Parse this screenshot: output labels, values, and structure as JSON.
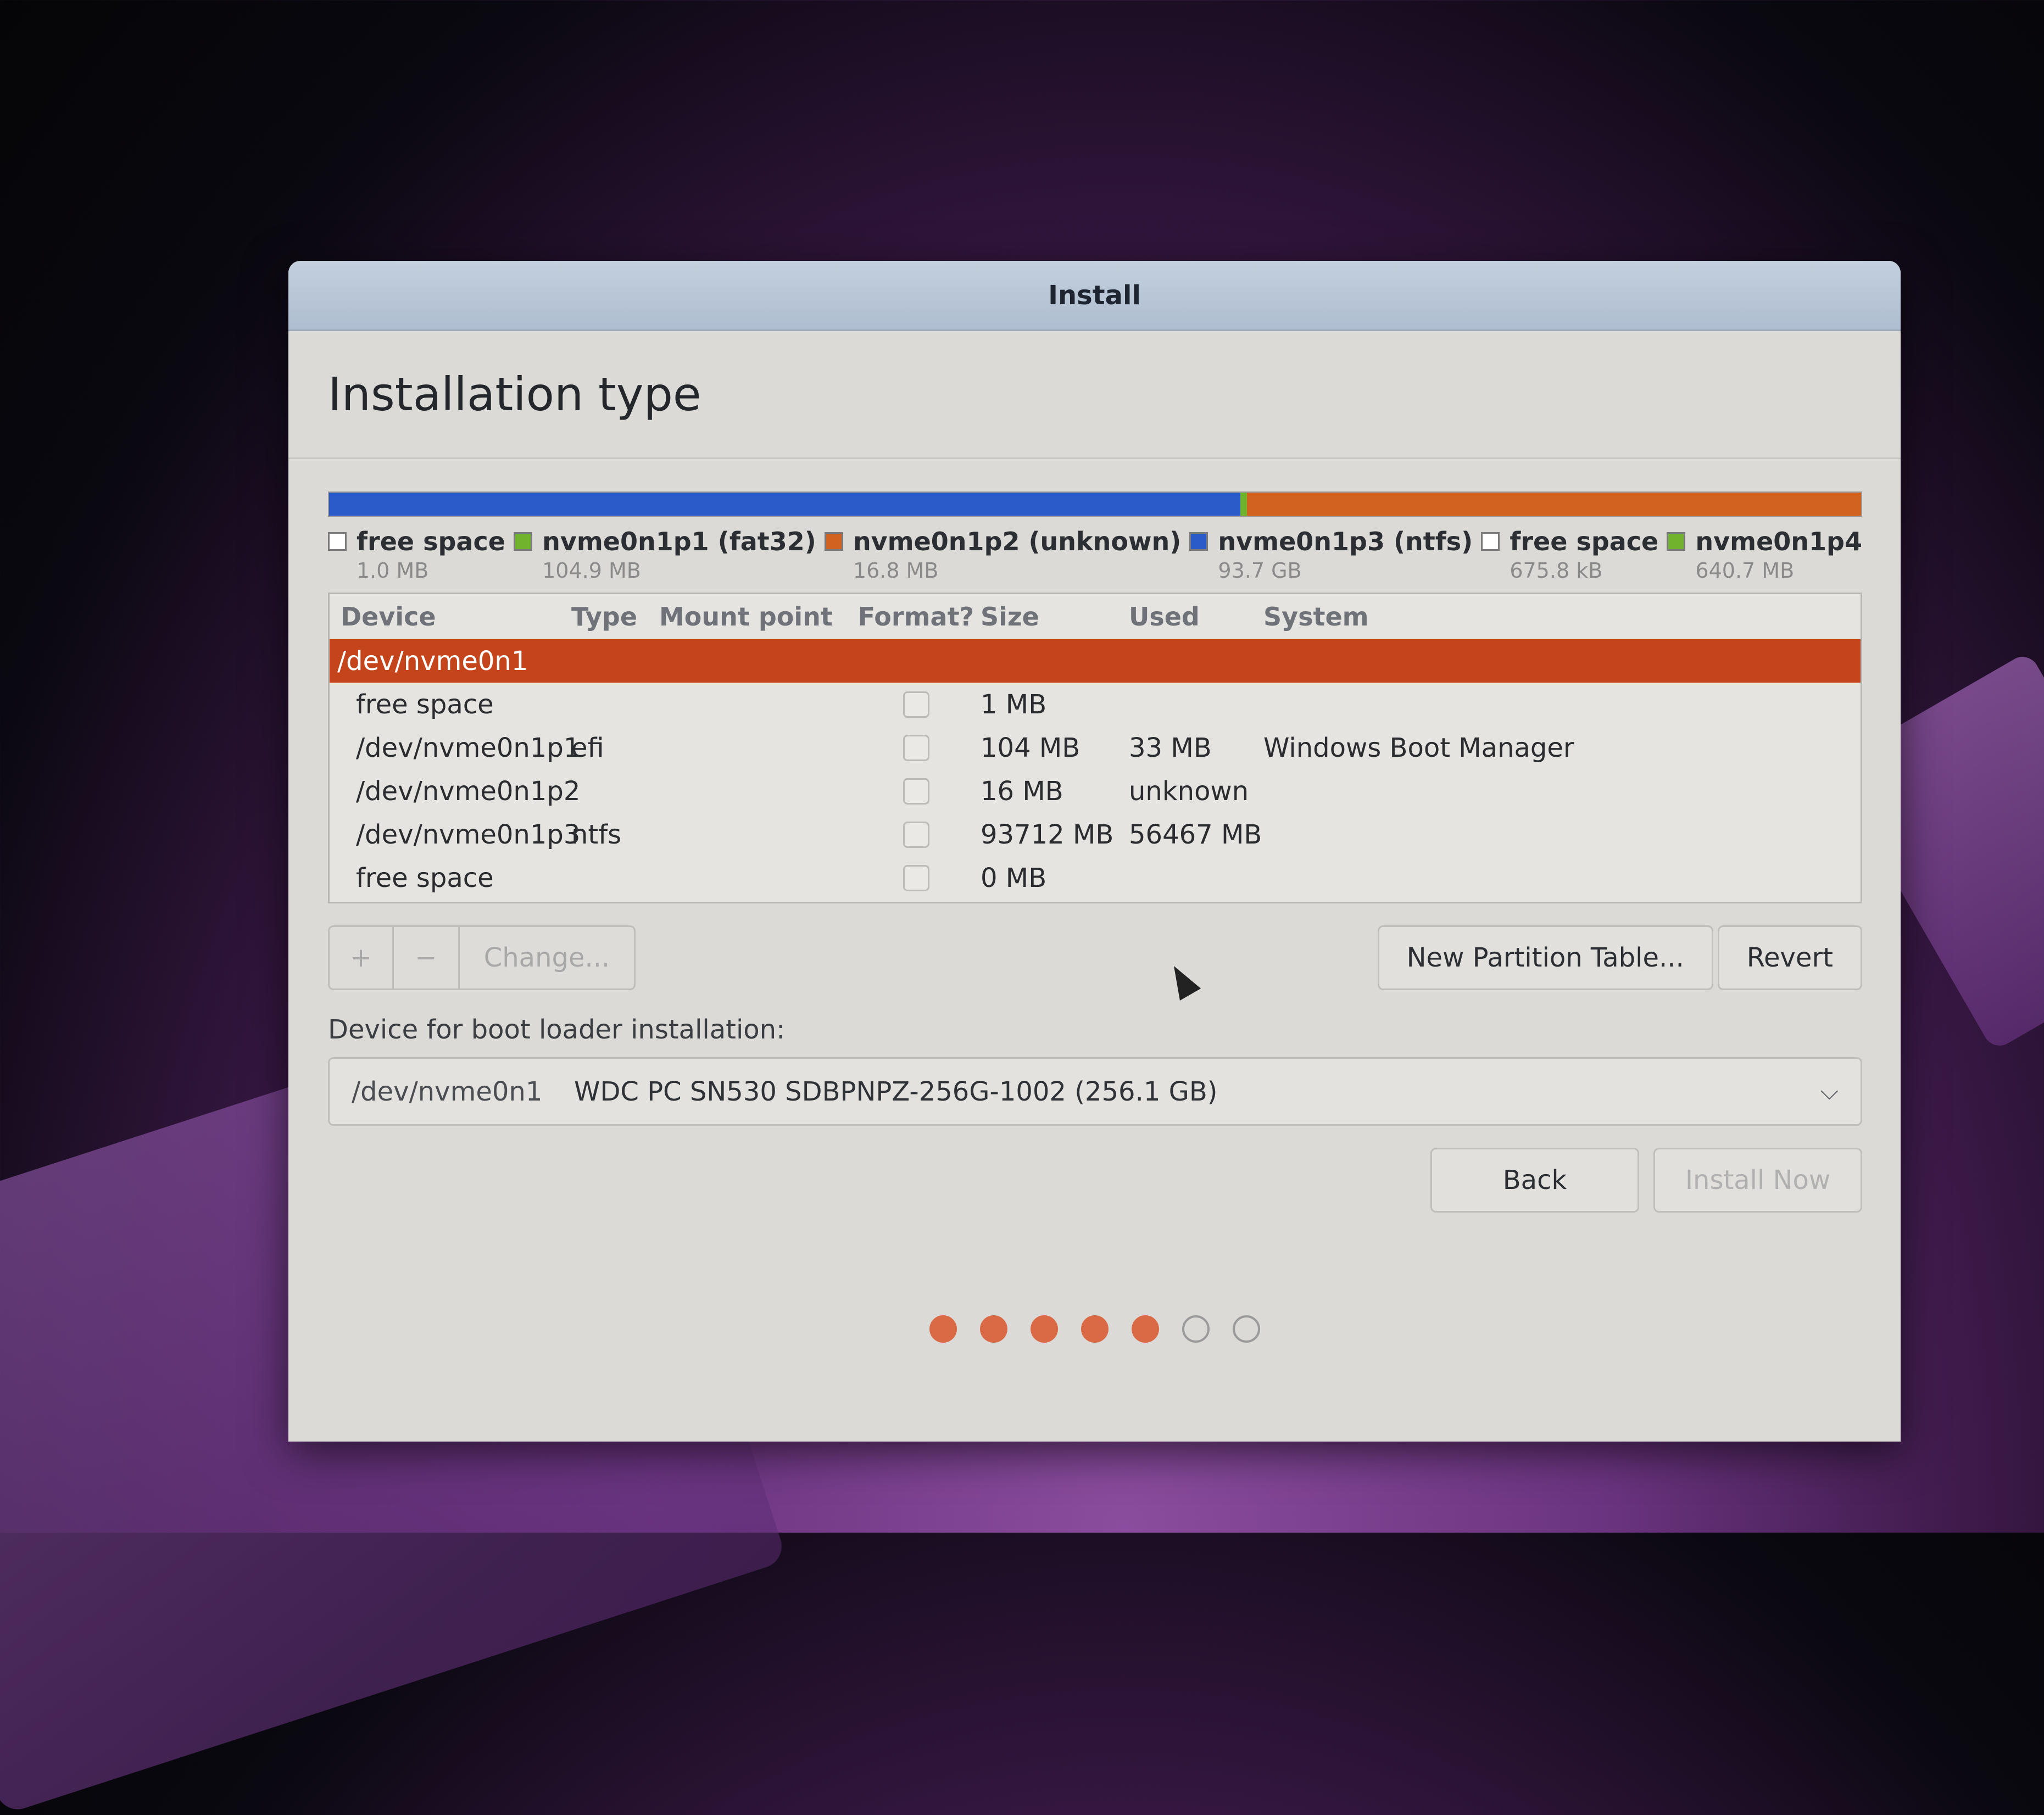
{
  "window": {
    "title": "Install"
  },
  "header": {
    "title": "Installation type"
  },
  "disk_bar": {
    "segments": [
      {
        "name": "nvme0n1p3",
        "color": "#2a5bc9",
        "fraction": 0.595
      },
      {
        "name": "nvme0n1p1",
        "color": "#6fb42c",
        "fraction": 0.004
      },
      {
        "name": "nvme0n1p2",
        "color": "#d1621f",
        "fraction": 0.401
      }
    ]
  },
  "legend": [
    {
      "name": "free space",
      "size": "1.0 MB",
      "color": "#ffffff"
    },
    {
      "name": "nvme0n1p1 (fat32)",
      "size": "104.9 MB",
      "color": "#6fb42c"
    },
    {
      "name": "nvme0n1p2 (unknown)",
      "size": "16.8 MB",
      "color": "#d1621f"
    },
    {
      "name": "nvme0n1p3 (ntfs)",
      "size": "93.7 GB",
      "color": "#2a5bc9"
    },
    {
      "name": "free space",
      "size": "675.8 kB",
      "color": "#ffffff"
    },
    {
      "name": "nvme0n1p4",
      "size": "640.7 MB",
      "color": "#6fb42c"
    }
  ],
  "table": {
    "columns": {
      "device": "Device",
      "type": "Type",
      "mount": "Mount point",
      "format": "Format?",
      "size": "Size",
      "used": "Used",
      "system": "System"
    },
    "disk_row": {
      "device": "/dev/nvme0n1"
    },
    "rows": [
      {
        "device": "free space",
        "type": "",
        "mount": "",
        "size": "1 MB",
        "used": "",
        "system": ""
      },
      {
        "device": "/dev/nvme0n1p1",
        "type": "efi",
        "mount": "",
        "size": "104 MB",
        "used": "33 MB",
        "system": "Windows Boot Manager"
      },
      {
        "device": "/dev/nvme0n1p2",
        "type": "",
        "mount": "",
        "size": "16 MB",
        "used": "unknown",
        "system": ""
      },
      {
        "device": "/dev/nvme0n1p3",
        "type": "ntfs",
        "mount": "",
        "size": "93712 MB",
        "used": "56467 MB",
        "system": ""
      },
      {
        "device": "free space",
        "type": "",
        "mount": "",
        "size": "0 MB",
        "used": "",
        "system": ""
      }
    ]
  },
  "toolbar": {
    "add": "+",
    "remove": "−",
    "change": "Change...",
    "new_table": "New Partition Table...",
    "revert": "Revert"
  },
  "boot_loader": {
    "label": "Device for boot loader installation:",
    "device": "/dev/nvme0n1",
    "description": "WDC PC SN530 SDBPNPZ-256G-1002 (256.1 GB)"
  },
  "nav": {
    "back": "Back",
    "install_now": "Install Now"
  },
  "progress": {
    "completed_steps": 5,
    "total_steps": 7
  }
}
